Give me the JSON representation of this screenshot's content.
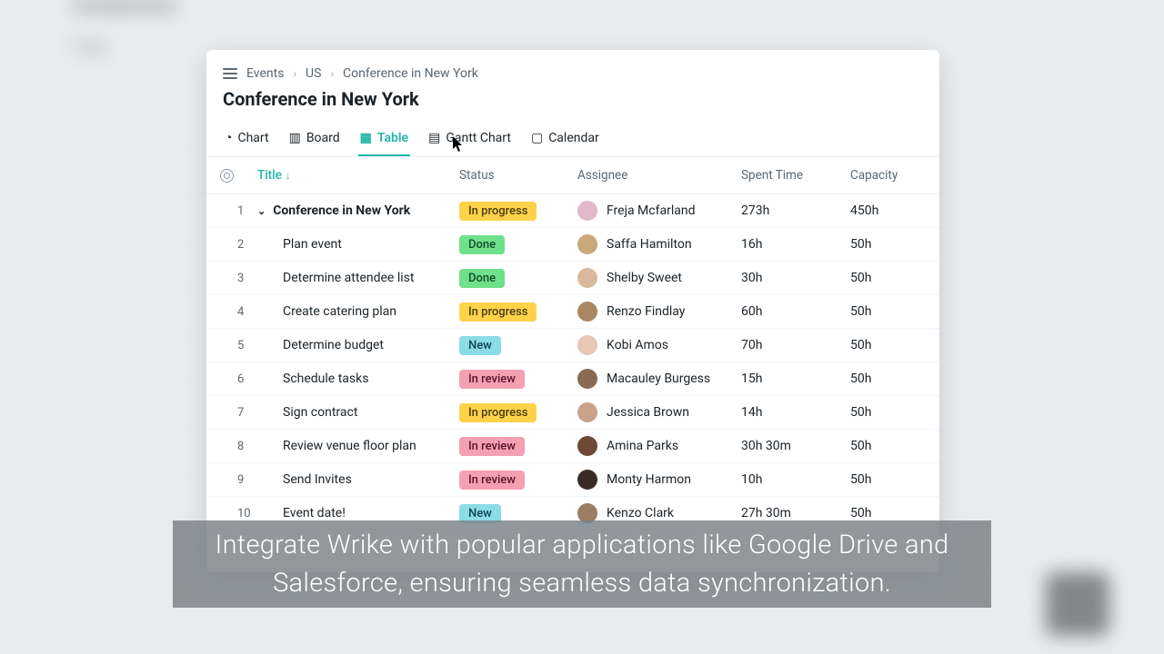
{
  "bg": {
    "title": "Conference",
    "filter": "Filter"
  },
  "breadcrumbs": [
    "Events",
    "US",
    "Conference in New York"
  ],
  "page_title": "Conference in New York",
  "tabs": [
    {
      "icon": "◔",
      "label": "Chart"
    },
    {
      "icon": "▥",
      "label": "Board"
    },
    {
      "icon": "▦",
      "label": "Table"
    },
    {
      "icon": "▤",
      "label": "Gantt Chart"
    },
    {
      "icon": "▢",
      "label": "Calendar"
    }
  ],
  "active_tab": 2,
  "columns": {
    "title": "Title",
    "status": "Status",
    "assignee": "Assignee",
    "spent": "Spent Time",
    "capacity": "Capacity"
  },
  "status_labels": {
    "progress": "In progress",
    "done": "Done",
    "new": "New",
    "review": "In review"
  },
  "rows": [
    {
      "n": "1",
      "title": "Conference in New York",
      "parent": true,
      "status": "progress",
      "assignee": "Freja Mcfarland",
      "avatar": "#e0b8c9",
      "spent": "273h",
      "capacity": "450h"
    },
    {
      "n": "2",
      "title": "Plan event",
      "parent": false,
      "status": "done",
      "assignee": "Saffa Hamilton",
      "avatar": "#c9a97a",
      "spent": "16h",
      "capacity": "50h"
    },
    {
      "n": "3",
      "title": "Determine attendee list",
      "parent": false,
      "status": "done",
      "assignee": "Shelby Sweet",
      "avatar": "#d9b89b",
      "spent": "30h",
      "capacity": "50h"
    },
    {
      "n": "4",
      "title": "Create catering plan",
      "parent": false,
      "status": "progress",
      "assignee": "Renzo Findlay",
      "avatar": "#a88762",
      "spent": "60h",
      "capacity": "50h"
    },
    {
      "n": "5",
      "title": "Determine budget",
      "parent": false,
      "status": "new",
      "assignee": "Kobi Amos",
      "avatar": "#e8c7b5",
      "spent": "70h",
      "capacity": "50h"
    },
    {
      "n": "6",
      "title": "Schedule tasks",
      "parent": false,
      "status": "review",
      "assignee": "Macauley Burgess",
      "avatar": "#8a6a52",
      "spent": "15h",
      "capacity": "50h"
    },
    {
      "n": "7",
      "title": "Sign contract",
      "parent": false,
      "status": "progress",
      "assignee": "Jessica Brown",
      "avatar": "#caa289",
      "spent": "14h",
      "capacity": "50h"
    },
    {
      "n": "8",
      "title": "Review venue floor plan",
      "parent": false,
      "status": "review",
      "assignee": "Amina Parks",
      "avatar": "#6e4a36",
      "spent": "30h 30m",
      "capacity": "50h"
    },
    {
      "n": "9",
      "title": "Send Invites",
      "parent": false,
      "status": "review",
      "assignee": "Monty Harmon",
      "avatar": "#3a2c24",
      "spent": "10h",
      "capacity": "50h"
    },
    {
      "n": "10",
      "title": "Event date!",
      "parent": false,
      "status": "new",
      "assignee": "Kenzo Clark",
      "avatar": "#9b7d64",
      "spent": "27h 30m",
      "capacity": "50h"
    }
  ],
  "caption": "Integrate Wrike with popular applications like Google Drive and Salesforce, ensuring seamless data synchronization."
}
